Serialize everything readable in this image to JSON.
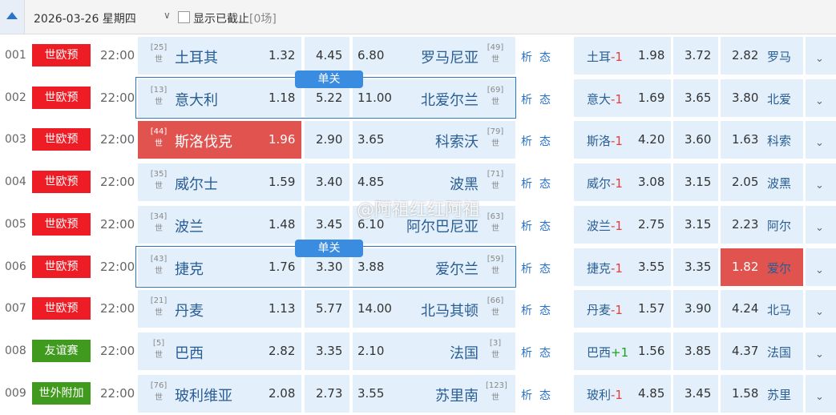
{
  "header": {
    "date": "2026-03-26 星期四",
    "dropdown": "∨",
    "show_ended_label": "显示已截止",
    "ended_count": "[0场]"
  },
  "links": {
    "analysis": "析",
    "status": "态"
  },
  "single_tag": "单关",
  "watermark": "@阿祖红红阿祖",
  "colors": {
    "red_badge": "#ee1c25",
    "green_badge": "#3f9a1e",
    "highlight": "#e0534f",
    "accent": "#2a73c8"
  },
  "matches": [
    {
      "num": "001",
      "league": "世欧预",
      "league_color": "#ee1c25",
      "time": "22:00",
      "home_rank": "25",
      "home_tag": "世",
      "home": "土耳其",
      "odds_w": "1.32",
      "odds_d": "4.45",
      "odds_l": "6.80",
      "away": "罗马尼亚",
      "away_rank": "49",
      "away_tag": "世",
      "h_team": "土耳",
      "h_val": "-1",
      "h_w": "1.98",
      "h_d": "3.72",
      "h_l": "2.82",
      "h_away": "罗马"
    },
    {
      "num": "002",
      "league": "世欧预",
      "league_color": "#ee1c25",
      "time": "22:00",
      "home_rank": "13",
      "home_tag": "世",
      "home": "意大利",
      "odds_w": "1.18",
      "odds_d": "5.22",
      "odds_l": "11.00",
      "away": "北爱尔兰",
      "away_rank": "69",
      "away_tag": "世",
      "h_team": "意大",
      "h_val": "-1",
      "h_w": "1.69",
      "h_d": "3.65",
      "h_l": "3.80",
      "h_away": "北爱"
    },
    {
      "num": "003",
      "league": "世欧预",
      "league_color": "#ee1c25",
      "time": "22:00",
      "home_rank": "44",
      "home_tag": "世",
      "home": "斯洛伐克",
      "odds_w": "1.96",
      "odds_d": "2.90",
      "odds_l": "3.65",
      "away": "科索沃",
      "away_rank": "79",
      "away_tag": "世",
      "h_team": "斯洛",
      "h_val": "-1",
      "h_w": "4.20",
      "h_d": "3.60",
      "h_l": "1.63",
      "h_away": "科索"
    },
    {
      "num": "004",
      "league": "世欧预",
      "league_color": "#ee1c25",
      "time": "22:00",
      "home_rank": "35",
      "home_tag": "世",
      "home": "威尔士",
      "odds_w": "1.59",
      "odds_d": "3.40",
      "odds_l": "4.85",
      "away": "波黑",
      "away_rank": "71",
      "away_tag": "世",
      "h_team": "威尔",
      "h_val": "-1",
      "h_w": "3.08",
      "h_d": "3.15",
      "h_l": "2.05",
      "h_away": "波黑"
    },
    {
      "num": "005",
      "league": "世欧预",
      "league_color": "#ee1c25",
      "time": "22:00",
      "home_rank": "34",
      "home_tag": "世",
      "home": "波兰",
      "odds_w": "1.48",
      "odds_d": "3.45",
      "odds_l": "6.10",
      "away": "阿尔巴尼亚",
      "away_rank": "63",
      "away_tag": "世",
      "h_team": "波兰",
      "h_val": "-1",
      "h_w": "2.75",
      "h_d": "3.15",
      "h_l": "2.23",
      "h_away": "阿尔"
    },
    {
      "num": "006",
      "league": "世欧预",
      "league_color": "#ee1c25",
      "time": "22:00",
      "home_rank": "43",
      "home_tag": "世",
      "home": "捷克",
      "odds_w": "1.76",
      "odds_d": "3.30",
      "odds_l": "3.88",
      "away": "爱尔兰",
      "away_rank": "59",
      "away_tag": "世",
      "h_team": "捷克",
      "h_val": "-1",
      "h_w": "3.55",
      "h_d": "3.35",
      "h_l": "1.82",
      "h_away": "爱尔"
    },
    {
      "num": "007",
      "league": "世欧预",
      "league_color": "#ee1c25",
      "time": "22:00",
      "home_rank": "21",
      "home_tag": "世",
      "home": "丹麦",
      "odds_w": "1.13",
      "odds_d": "5.77",
      "odds_l": "14.00",
      "away": "北马其顿",
      "away_rank": "66",
      "away_tag": "世",
      "h_team": "丹麦",
      "h_val": "-1",
      "h_w": "1.57",
      "h_d": "3.90",
      "h_l": "4.24",
      "h_away": "北马"
    },
    {
      "num": "008",
      "league": "友谊赛",
      "league_color": "#3f9a1e",
      "time": "22:00",
      "home_rank": "5",
      "home_tag": "世",
      "home": "巴西",
      "odds_w": "2.82",
      "odds_d": "3.35",
      "odds_l": "2.10",
      "away": "法国",
      "away_rank": "3",
      "away_tag": "世",
      "h_team": "巴西",
      "h_val": "+1",
      "h_w": "1.56",
      "h_d": "3.85",
      "h_l": "4.37",
      "h_away": "法国"
    },
    {
      "num": "009",
      "league": "世外附加",
      "league_color": "#3f9a1e",
      "time": "22:00",
      "home_rank": "76",
      "home_tag": "世",
      "home": "玻利维亚",
      "odds_w": "2.08",
      "odds_d": "2.73",
      "odds_l": "3.55",
      "away": "苏里南",
      "away_rank": "123",
      "away_tag": "世",
      "h_team": "玻利",
      "h_val": "-1",
      "h_w": "4.85",
      "h_d": "3.45",
      "h_l": "1.58",
      "h_away": "苏里"
    }
  ]
}
